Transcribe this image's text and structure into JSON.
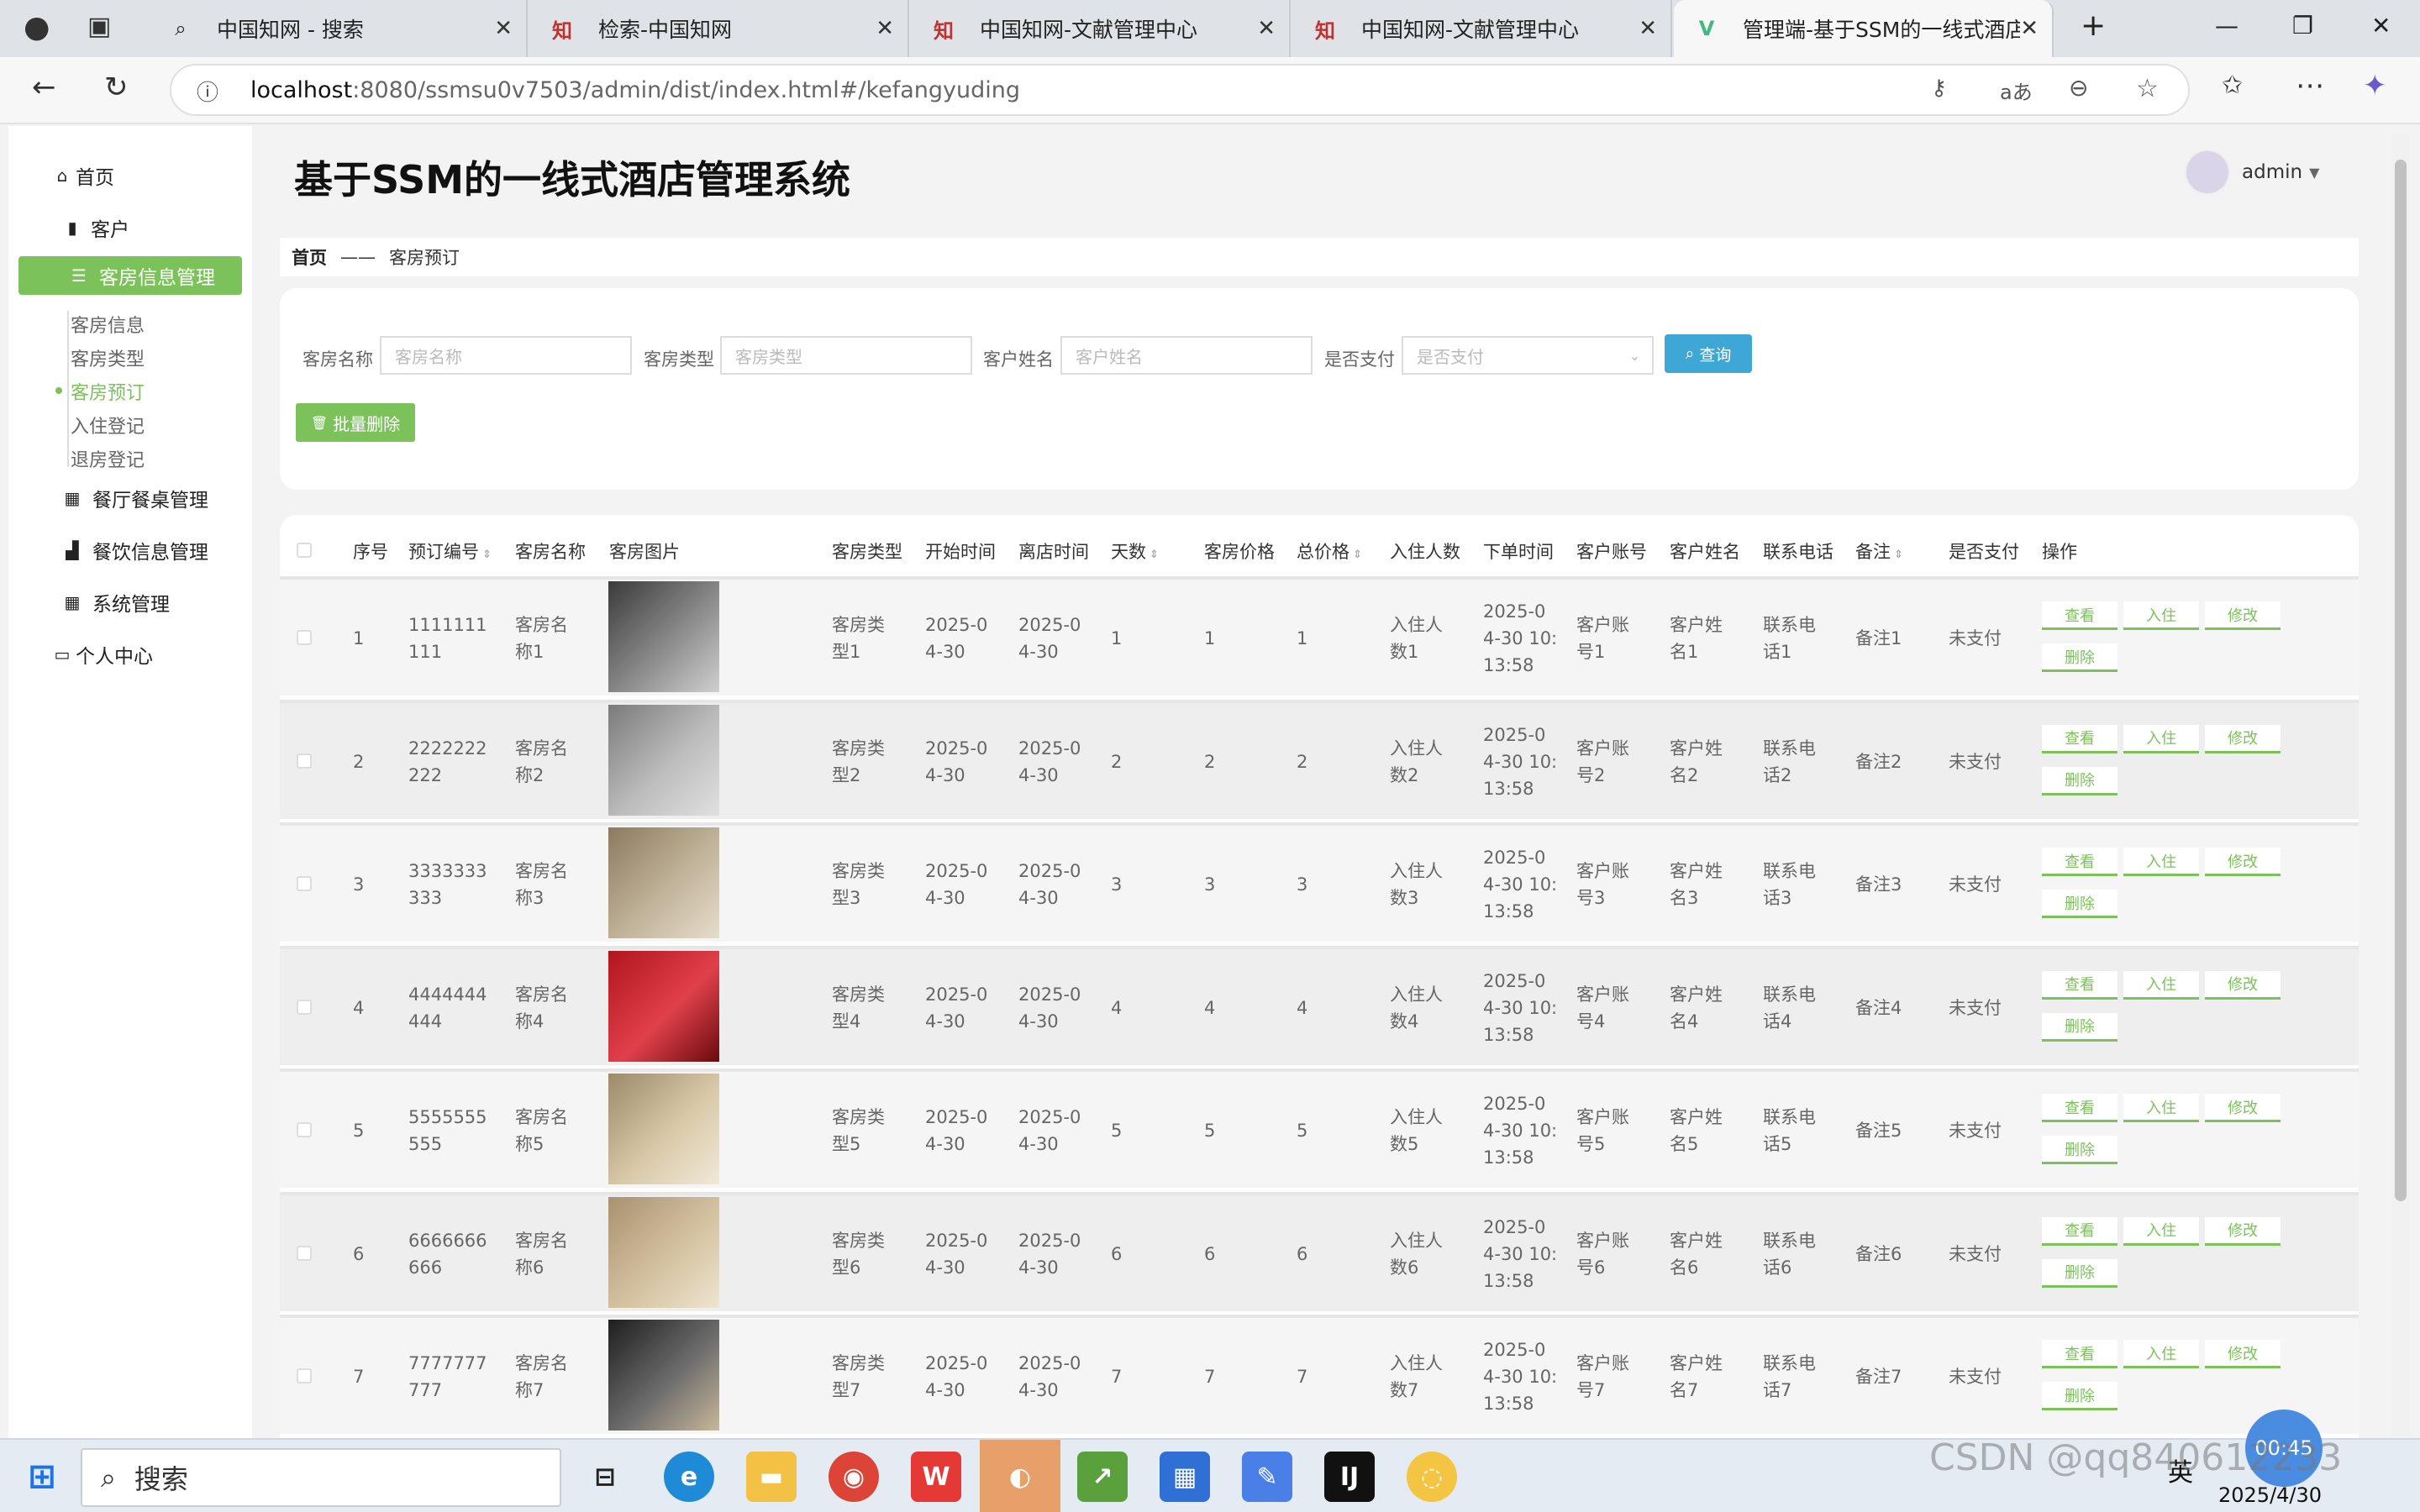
{
  "browser": {
    "tabs": [
      {
        "title": "中国知网 - 搜索",
        "icon": "search-icon"
      },
      {
        "title": "检索-中国知网",
        "icon": "cnki-icon"
      },
      {
        "title": "中国知网-文献管理中心",
        "icon": "cnki-icon"
      },
      {
        "title": "中国知网-文献管理中心",
        "icon": "cnki-icon"
      },
      {
        "title": "管理端-基于SSM的一线式酒店",
        "icon": "vue-icon"
      }
    ],
    "url_host": "localhost",
    "url_path": ":8080/ssmsu0v7503/admin/dist/index.html#/kefangyuding"
  },
  "app": {
    "title": "基于SSM的一线式酒店管理系统",
    "user": "admin",
    "accent": "#7bc25a"
  },
  "sidebar": {
    "items": [
      {
        "label": "首页",
        "icon": "home-icon"
      },
      {
        "label": "客户",
        "icon": "clipboard-icon"
      },
      {
        "label": "客房信息管理",
        "icon": "list-icon"
      },
      {
        "label": "餐厅餐桌管理",
        "icon": "grid-icon"
      },
      {
        "label": "餐饮信息管理",
        "icon": "bar-chart-icon"
      },
      {
        "label": "系统管理",
        "icon": "grid-icon"
      },
      {
        "label": "个人中心",
        "icon": "calendar-icon"
      }
    ],
    "subitems": [
      "客房信息",
      "客房类型",
      "客房预订",
      "入住登记",
      "退房登记"
    ]
  },
  "breadcrumb": {
    "home": "首页",
    "sep": "——",
    "current": "客房预订"
  },
  "filters": {
    "room_name_label": "客房名称",
    "room_name_placeholder": "客房名称",
    "room_type_label": "客房类型",
    "room_type_placeholder": "客房类型",
    "customer_name_label": "客户姓名",
    "customer_name_placeholder": "客户姓名",
    "paid_label": "是否支付",
    "paid_placeholder": "是否支付",
    "search_button": "查询",
    "batch_delete_button": "批量删除"
  },
  "table": {
    "headers": [
      "序号",
      "预订编号",
      "客房名称",
      "客房图片",
      "客房类型",
      "开始时间",
      "离店时间",
      "天数",
      "客房价格",
      "总价格",
      "入住人数",
      "下单时间",
      "客户账号",
      "客户姓名",
      "联系电话",
      "备注",
      "是否支付",
      "操作"
    ],
    "actions": {
      "view": "查看",
      "checkin": "入住",
      "edit": "修改",
      "delete": "删除"
    },
    "rows": [
      {
        "idx": "1",
        "code1": "1111111",
        "code2": "111",
        "name1": "客房名",
        "name2": "称1",
        "type1": "客房类",
        "type2": "型1",
        "start1": "2025-0",
        "start2": "4-30",
        "end1": "2025-0",
        "end2": "4-30",
        "days": "1",
        "price": "1",
        "total": "1",
        "ppl1": "入住人",
        "ppl2": "数1",
        "time1": "2025-0",
        "time2": "4-30 10:",
        "time3": "13:58",
        "acct1": "客户账",
        "acct2": "号1",
        "cname1": "客户姓",
        "cname2": "名1",
        "phone1": "联系电",
        "phone2": "话1",
        "note": "备注1",
        "paid": "未支付"
      },
      {
        "idx": "2",
        "code1": "2222222",
        "code2": "222",
        "name1": "客房名",
        "name2": "称2",
        "type1": "客房类",
        "type2": "型2",
        "start1": "2025-0",
        "start2": "4-30",
        "end1": "2025-0",
        "end2": "4-30",
        "days": "2",
        "price": "2",
        "total": "2",
        "ppl1": "入住人",
        "ppl2": "数2",
        "time1": "2025-0",
        "time2": "4-30 10:",
        "time3": "13:58",
        "acct1": "客户账",
        "acct2": "号2",
        "cname1": "客户姓",
        "cname2": "名2",
        "phone1": "联系电",
        "phone2": "话2",
        "note": "备注2",
        "paid": "未支付"
      },
      {
        "idx": "3",
        "code1": "3333333",
        "code2": "333",
        "name1": "客房名",
        "name2": "称3",
        "type1": "客房类",
        "type2": "型3",
        "start1": "2025-0",
        "start2": "4-30",
        "end1": "2025-0",
        "end2": "4-30",
        "days": "3",
        "price": "3",
        "total": "3",
        "ppl1": "入住人",
        "ppl2": "数3",
        "time1": "2025-0",
        "time2": "4-30 10:",
        "time3": "13:58",
        "acct1": "客户账",
        "acct2": "号3",
        "cname1": "客户姓",
        "cname2": "名3",
        "phone1": "联系电",
        "phone2": "话3",
        "note": "备注3",
        "paid": "未支付"
      },
      {
        "idx": "4",
        "code1": "4444444",
        "code2": "444",
        "name1": "客房名",
        "name2": "称4",
        "type1": "客房类",
        "type2": "型4",
        "start1": "2025-0",
        "start2": "4-30",
        "end1": "2025-0",
        "end2": "4-30",
        "days": "4",
        "price": "4",
        "total": "4",
        "ppl1": "入住人",
        "ppl2": "数4",
        "time1": "2025-0",
        "time2": "4-30 10:",
        "time3": "13:58",
        "acct1": "客户账",
        "acct2": "号4",
        "cname1": "客户姓",
        "cname2": "名4",
        "phone1": "联系电",
        "phone2": "话4",
        "note": "备注4",
        "paid": "未支付"
      },
      {
        "idx": "5",
        "code1": "5555555",
        "code2": "555",
        "name1": "客房名",
        "name2": "称5",
        "type1": "客房类",
        "type2": "型5",
        "start1": "2025-0",
        "start2": "4-30",
        "end1": "2025-0",
        "end2": "4-30",
        "days": "5",
        "price": "5",
        "total": "5",
        "ppl1": "入住人",
        "ppl2": "数5",
        "time1": "2025-0",
        "time2": "4-30 10:",
        "time3": "13:58",
        "acct1": "客户账",
        "acct2": "号5",
        "cname1": "客户姓",
        "cname2": "名5",
        "phone1": "联系电",
        "phone2": "话5",
        "note": "备注5",
        "paid": "未支付"
      },
      {
        "idx": "6",
        "code1": "6666666",
        "code2": "666",
        "name1": "客房名",
        "name2": "称6",
        "type1": "客房类",
        "type2": "型6",
        "start1": "2025-0",
        "start2": "4-30",
        "end1": "2025-0",
        "end2": "4-30",
        "days": "6",
        "price": "6",
        "total": "6",
        "ppl1": "入住人",
        "ppl2": "数6",
        "time1": "2025-0",
        "time2": "4-30 10:",
        "time3": "13:58",
        "acct1": "客户账",
        "acct2": "号6",
        "cname1": "客户姓",
        "cname2": "名6",
        "phone1": "联系电",
        "phone2": "话6",
        "note": "备注6",
        "paid": "未支付"
      },
      {
        "idx": "7",
        "code1": "7777777",
        "code2": "777",
        "name1": "客房名",
        "name2": "称7",
        "type1": "客房类",
        "type2": "型7",
        "start1": "2025-0",
        "start2": "4-30",
        "end1": "2025-0",
        "end2": "4-30",
        "days": "7",
        "price": "7",
        "total": "7",
        "ppl1": "入住人",
        "ppl2": "数7",
        "time1": "2025-0",
        "time2": "4-30 10:",
        "time3": "13:58",
        "acct1": "客户账",
        "acct2": "号7",
        "cname1": "客户姓",
        "cname2": "名7",
        "phone1": "联系电",
        "phone2": "话7",
        "note": "备注7",
        "paid": "未支付"
      }
    ]
  },
  "taskbar": {
    "search_placeholder": "搜索",
    "date": "2025/4/30",
    "lang": "英",
    "timer": "00:45",
    "watermark": "CSDN @qq840612233"
  }
}
